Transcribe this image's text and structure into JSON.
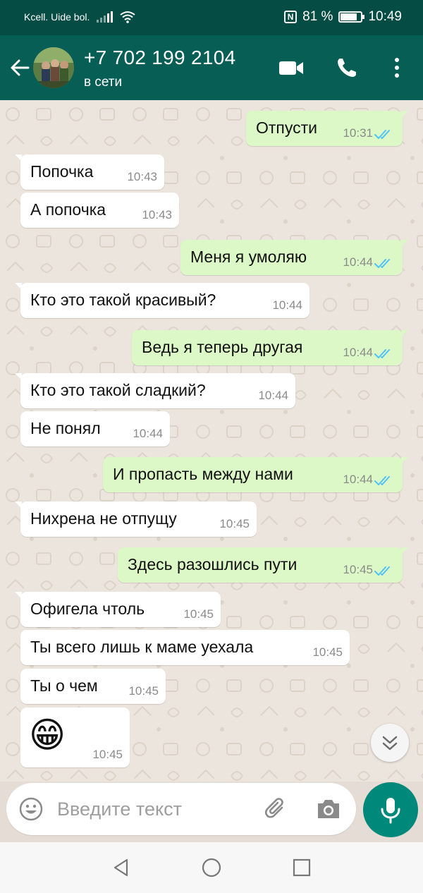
{
  "status_bar": {
    "carrier": "Kcell. Uide bol.",
    "battery_percent": "81 %",
    "battery_level": 0.81,
    "time": "10:49"
  },
  "header": {
    "contact_name": "+7 702 199 2104",
    "contact_status": "в сети",
    "icons": [
      "back-arrow-icon",
      "video-call-icon",
      "phone-icon",
      "more-vert-icon"
    ],
    "bar_color": "#075e54"
  },
  "messages": [
    {
      "direction": "out",
      "text": "Отпусти",
      "time": "10:31",
      "read": true
    },
    {
      "direction": "in",
      "text": "Попочка",
      "time": "10:43"
    },
    {
      "direction": "in",
      "text": "А попочка",
      "time": "10:43"
    },
    {
      "direction": "out",
      "text": "Меня я умоляю",
      "time": "10:44",
      "read": true
    },
    {
      "direction": "in",
      "text": "Кто это такой красивый?",
      "time": "10:44"
    },
    {
      "direction": "out",
      "text": "Ведь я теперь другая",
      "time": "10:44",
      "read": true
    },
    {
      "direction": "in",
      "text": "Кто это такой сладкий?",
      "time": "10:44"
    },
    {
      "direction": "in",
      "text": "Не понял",
      "time": "10:44"
    },
    {
      "direction": "out",
      "text": "И пропасть между нами",
      "time": "10:44",
      "read": true
    },
    {
      "direction": "in",
      "text": "Нихрена не отпущу",
      "time": "10:45"
    },
    {
      "direction": "out",
      "text": "Здесь разошлись пути",
      "time": "10:45",
      "read": true
    },
    {
      "direction": "in",
      "text": "Офигела чтоль",
      "time": "10:45"
    },
    {
      "direction": "in",
      "text": "Ты всего лишь к маме уехала",
      "time": "10:45"
    },
    {
      "direction": "in",
      "text": "Ты о чем",
      "time": "10:45"
    },
    {
      "direction": "in",
      "text": "😁",
      "time": "10:45",
      "emoji": true
    }
  ],
  "composer": {
    "placeholder": "Введите текст",
    "icons": [
      "emoji-icon",
      "attach-icon",
      "camera-icon",
      "mic-icon"
    ]
  },
  "colors": {
    "incoming": "#ffffff",
    "outgoing": "#dcf8c6",
    "read_ticks": "#4fc3f7",
    "accent": "#00897b"
  }
}
